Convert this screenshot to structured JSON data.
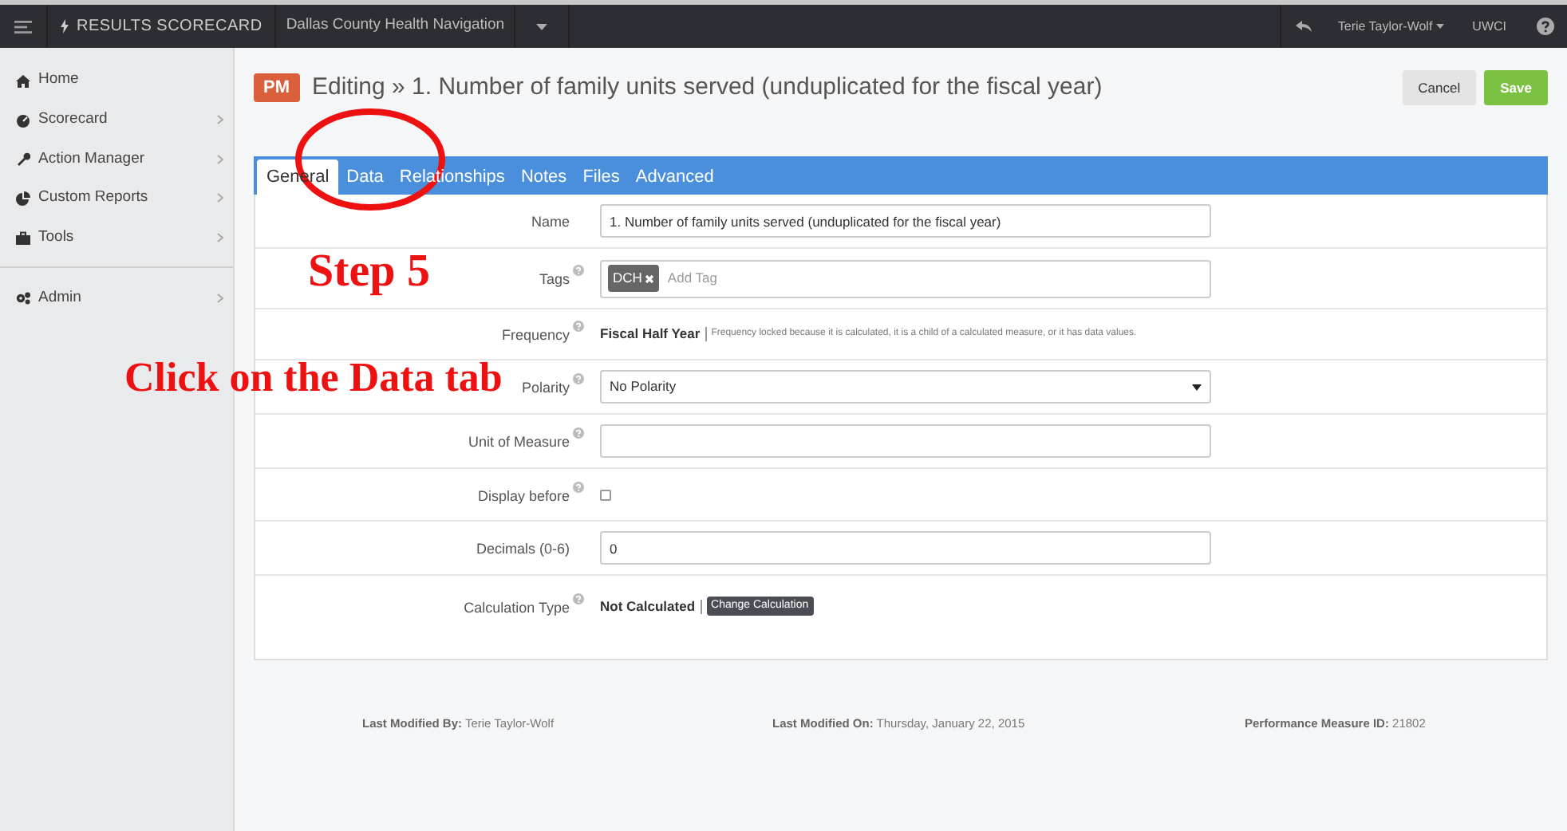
{
  "top_bar": {
    "app_name": "RESULTS SCORECARD",
    "organization": "Dallas County Health Navigation",
    "user": "Terie Taylor-Wolf",
    "org_code": "UWCI"
  },
  "sidebar": {
    "items": [
      {
        "label": "Home",
        "has_submenu": false
      },
      {
        "label": "Scorecard",
        "has_submenu": true
      },
      {
        "label": "Action Manager",
        "has_submenu": true
      },
      {
        "label": "Custom Reports",
        "has_submenu": true
      },
      {
        "label": "Tools",
        "has_submenu": true
      },
      {
        "label": "Admin",
        "has_submenu": true,
        "separated": true
      }
    ]
  },
  "header": {
    "badge": "PM",
    "title": "Editing » 1. Number of family units served (unduplicated for the fiscal year)",
    "buttons": [
      {
        "label": "Cancel",
        "kind": "default"
      },
      {
        "label": "Save",
        "kind": "primary"
      }
    ]
  },
  "tabs": [
    {
      "label": "General",
      "selected": true
    },
    {
      "label": "Data",
      "selected": false
    },
    {
      "label": "Relationships",
      "selected": false
    },
    {
      "label": "Notes",
      "selected": false
    },
    {
      "label": "Files",
      "selected": false
    },
    {
      "label": "Advanced",
      "selected": false
    }
  ],
  "form": [
    {
      "kind": "text",
      "label": "Name",
      "help": false,
      "value": "1. Number of family units served (unduplicated for the fiscal year)"
    },
    {
      "kind": "tags",
      "label": "Tags",
      "help": true,
      "tags": [
        "DCH"
      ],
      "placeholder": "Add Tag"
    },
    {
      "kind": "static",
      "label": "Frequency",
      "help": true,
      "value": "Fiscal Half Year",
      "note": "Frequency locked because it is calculated, it is a child of a calculated measure, or it has data values."
    },
    {
      "kind": "select",
      "label": "Polarity",
      "help": true,
      "value": "No Polarity"
    },
    {
      "kind": "text",
      "label": "Unit of Measure",
      "help": true
    },
    {
      "kind": "checkbox",
      "label": "Display before",
      "help": true,
      "checked": false
    },
    {
      "kind": "text",
      "label": "Decimals (0-6)",
      "help": false,
      "value": "0"
    },
    {
      "kind": "calc",
      "label": "Calculation Type",
      "help": true,
      "value": "Not Calculated",
      "action": "Change Calculation"
    }
  ],
  "footer": [
    {
      "label": "Last Modified By:",
      "value": "Terie Taylor-Wolf"
    },
    {
      "label": "Last Modified On:",
      "value": "Thursday, January 22, 2015"
    },
    {
      "label": "Performance Measure ID:",
      "value": "21802"
    }
  ],
  "annotations": {
    "step": "Step 5",
    "instruction": "Click on the Data tab"
  }
}
